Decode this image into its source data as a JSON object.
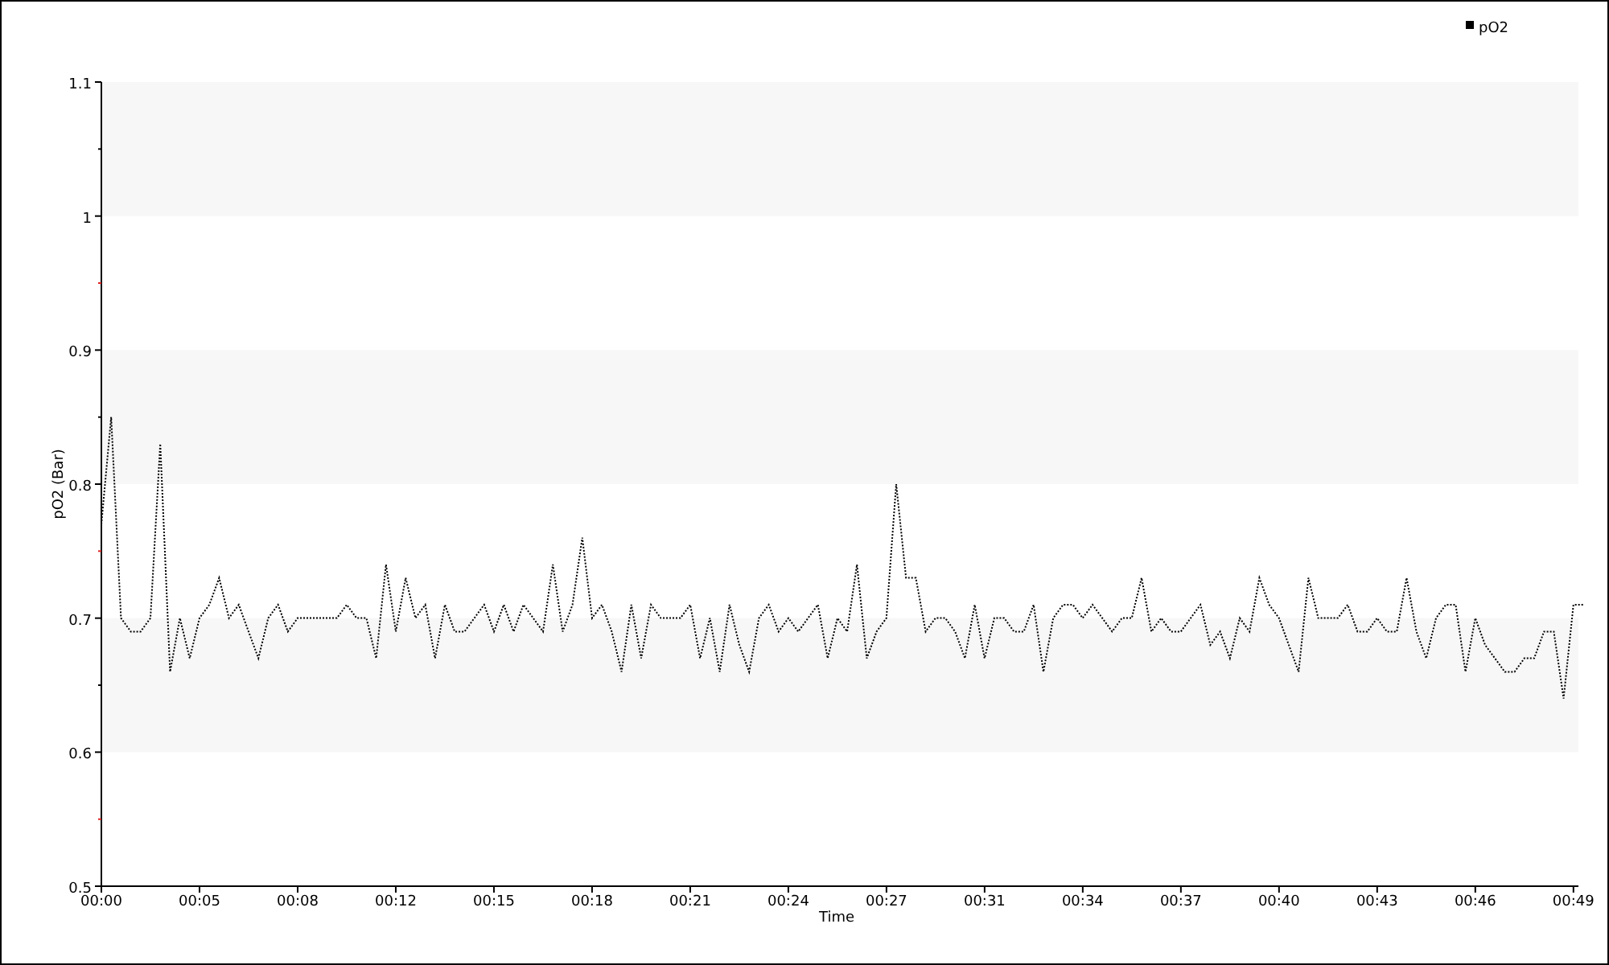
{
  "chart": {
    "chart_data": {
      "type": "line",
      "xlabel": "Time",
      "ylabel": "pO2 (Bar)",
      "ylim": [
        0.5,
        1.1
      ],
      "yticks": [
        0.5,
        0.6,
        0.7,
        0.8,
        0.9,
        1,
        1.1
      ],
      "categories": [
        "00:00",
        null,
        null,
        null,
        null,
        null,
        null,
        null,
        null,
        null,
        "00:05",
        null,
        null,
        null,
        null,
        null,
        null,
        null,
        null,
        null,
        "00:08",
        null,
        null,
        null,
        null,
        null,
        null,
        null,
        null,
        null,
        "00:12",
        null,
        null,
        null,
        null,
        null,
        null,
        null,
        null,
        null,
        "00:15",
        null,
        null,
        null,
        null,
        null,
        null,
        null,
        null,
        null,
        "00:18",
        null,
        null,
        null,
        null,
        null,
        null,
        null,
        null,
        null,
        "00:21",
        null,
        null,
        null,
        null,
        null,
        null,
        null,
        null,
        null,
        "00:24",
        null,
        null,
        null,
        null,
        null,
        null,
        null,
        null,
        null,
        "00:27",
        null,
        null,
        null,
        null,
        null,
        null,
        null,
        null,
        null,
        "00:31",
        null,
        null,
        null,
        null,
        null,
        null,
        null,
        null,
        null,
        "00:34",
        null,
        null,
        null,
        null,
        null,
        null,
        null,
        null,
        null,
        "00:37",
        null,
        null,
        null,
        null,
        null,
        null,
        null,
        null,
        null,
        "00:40",
        null,
        null,
        null,
        null,
        null,
        null,
        null,
        null,
        null,
        "00:43",
        null,
        null,
        null,
        null,
        null,
        null,
        null,
        null,
        null,
        "00:46",
        null,
        null,
        null,
        null,
        null,
        null,
        null,
        null,
        null,
        "00:49",
        null
      ],
      "series": [
        {
          "name": "pO2",
          "color": "#000000",
          "line_style": "dotted",
          "values": [
            0.77,
            0.85,
            0.7,
            0.69,
            0.69,
            0.7,
            0.83,
            0.66,
            0.7,
            0.67,
            0.7,
            0.71,
            0.73,
            0.7,
            0.71,
            0.69,
            0.67,
            0.7,
            0.71,
            0.69,
            0.7,
            0.7,
            0.7,
            0.7,
            0.7,
            0.71,
            0.7,
            0.7,
            0.67,
            0.74,
            0.69,
            0.73,
            0.7,
            0.71,
            0.67,
            0.71,
            0.69,
            0.69,
            0.7,
            0.71,
            0.69,
            0.71,
            0.69,
            0.71,
            0.7,
            0.69,
            0.74,
            0.69,
            0.71,
            0.76,
            0.7,
            0.71,
            0.69,
            0.66,
            0.71,
            0.67,
            0.71,
            0.7,
            0.7,
            0.7,
            0.71,
            0.67,
            0.7,
            0.66,
            0.71,
            0.68,
            0.66,
            0.7,
            0.71,
            0.69,
            0.7,
            0.69,
            0.7,
            0.71,
            0.67,
            0.7,
            0.69,
            0.74,
            0.67,
            0.69,
            0.7,
            0.8,
            0.73,
            0.73,
            0.69,
            0.7,
            0.7,
            0.69,
            0.67,
            0.71,
            0.67,
            0.7,
            0.7,
            0.69,
            0.69,
            0.71,
            0.66,
            0.7,
            0.71,
            0.71,
            0.7,
            0.71,
            0.7,
            0.69,
            0.7,
            0.7,
            0.73,
            0.69,
            0.7,
            0.69,
            0.69,
            0.7,
            0.71,
            0.68,
            0.69,
            0.67,
            0.7,
            0.69,
            0.73,
            0.71,
            0.7,
            0.68,
            0.66,
            0.73,
            0.7,
            0.7,
            0.7,
            0.71,
            0.69,
            0.69,
            0.7,
            0.69,
            0.69,
            0.73,
            0.69,
            0.67,
            0.7,
            0.71,
            0.71,
            0.66,
            0.7,
            0.68,
            0.67,
            0.66,
            0.66,
            0.67,
            0.67,
            0.69,
            0.69,
            0.64,
            0.71,
            0.71
          ]
        }
      ]
    }
  }
}
